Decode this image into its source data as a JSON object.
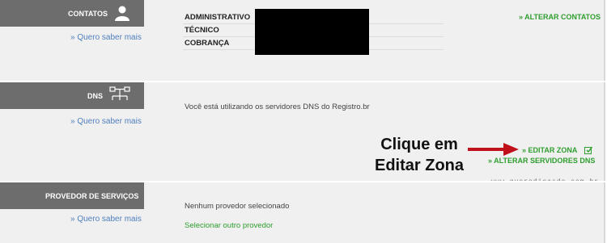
{
  "contacts": {
    "title": "CONTATOS",
    "more_link": "» Quero saber mais",
    "rows": [
      "ADMINISTRATIVO",
      "TÉCNICO",
      "COBRANÇA"
    ],
    "change_link": "» ALTERAR CONTATOS"
  },
  "dns": {
    "title": "DNS",
    "more_link": "» Quero saber mais",
    "info": "Você está utilizando os servidores DNS do Registro.br",
    "edit_zone": "» EDITAR ZONA",
    "change_servers": "» ALTERAR SERVIDORES DNS"
  },
  "annotation": {
    "line1": "Clique em",
    "line2": "Editar Zona",
    "color": "#c0101a"
  },
  "watermark": "www.querodicasde.com.br",
  "provider": {
    "title": "PROVEDOR DE SERVIÇOS",
    "more_link": "» Quero saber mais",
    "info": "Nenhum provedor selecionado",
    "select_link": "Selecionar outro provedor"
  }
}
